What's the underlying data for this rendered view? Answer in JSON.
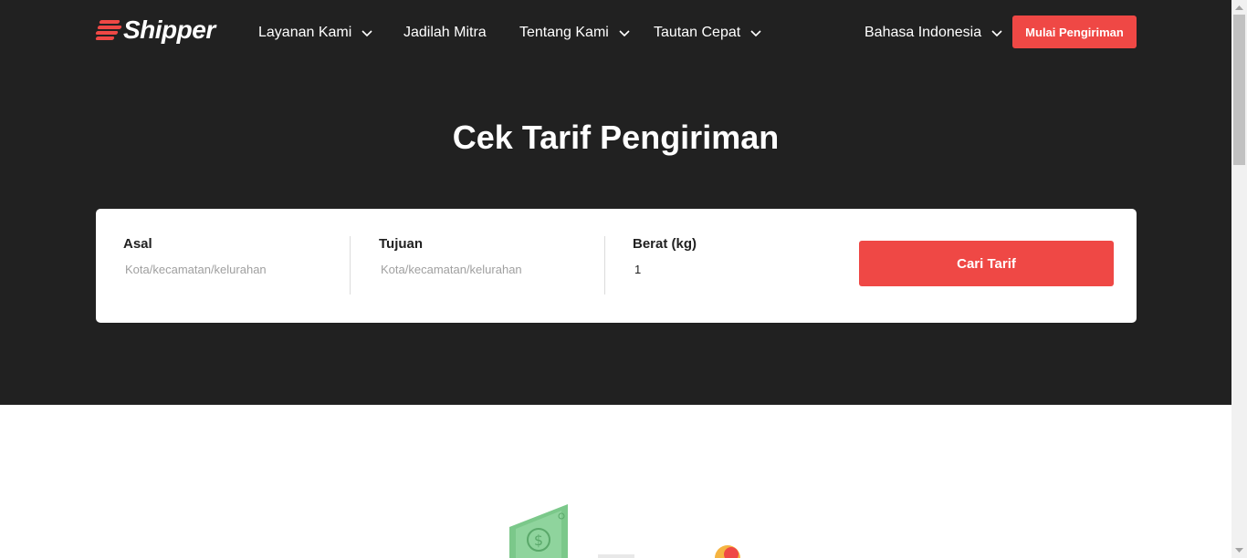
{
  "brand": {
    "name": "Shipper"
  },
  "nav": {
    "items": [
      {
        "label": "Layanan Kami",
        "has_dropdown": true
      },
      {
        "label": "Jadilah Mitra",
        "has_dropdown": false
      },
      {
        "label": "Tentang Kami",
        "has_dropdown": true
      },
      {
        "label": "Tautan Cepat",
        "has_dropdown": true
      }
    ],
    "language": "Bahasa Indonesia",
    "cta_label": "Mulai Pengiriman"
  },
  "hero": {
    "title": "Cek Tarif Pengiriman"
  },
  "form": {
    "origin": {
      "label": "Asal",
      "placeholder": "Kota/kecamatan/kelurahan",
      "value": ""
    },
    "destination": {
      "label": "Tujuan",
      "placeholder": "Kota/kecamatan/kelurahan",
      "value": ""
    },
    "weight": {
      "label": "Berat (kg)",
      "value": "1"
    },
    "submit_label": "Cari Tarif"
  },
  "colors": {
    "accent": "#ef4845",
    "hero_bg": "#212121",
    "card_bg": "#ffffff"
  },
  "icons": [
    "shipper-logo-icon",
    "chevron-down-icon",
    "money-bill-icon"
  ]
}
